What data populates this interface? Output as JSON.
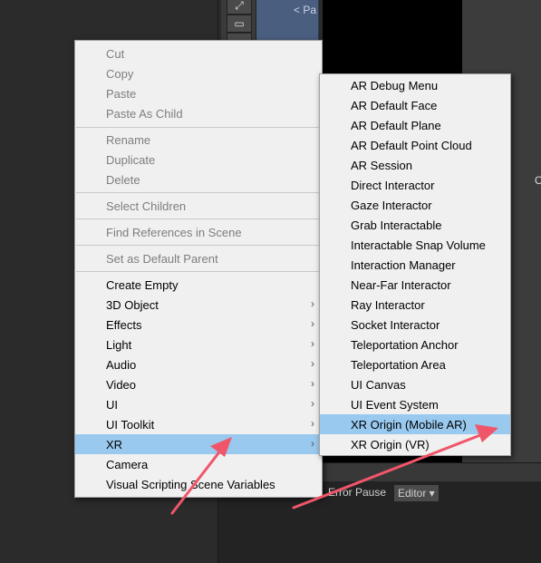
{
  "tool_icons": [
    "move-tool-icon",
    "rect-tool-icon",
    "transform-tool-icon"
  ],
  "panel_text": "< Pa",
  "bottom_toolbar": {
    "error_pause": "Error Pause",
    "editor": "Editor ▾"
  },
  "side_char": "O",
  "context_menu": {
    "cut": "Cut",
    "copy": "Copy",
    "paste": "Paste",
    "paste_as_child": "Paste As Child",
    "rename": "Rename",
    "duplicate": "Duplicate",
    "delete": "Delete",
    "select_children": "Select Children",
    "find_references": "Find References in Scene",
    "set_default_parent": "Set as Default Parent",
    "create_empty": "Create Empty",
    "object_3d": "3D Object",
    "effects": "Effects",
    "light": "Light",
    "audio": "Audio",
    "video": "Video",
    "ui": "UI",
    "ui_toolkit": "UI Toolkit",
    "xr": "XR",
    "camera": "Camera",
    "visual_scripting": "Visual Scripting Scene Variables",
    "submenu_arrow": "›"
  },
  "xr_submenu": [
    "AR Debug Menu",
    "AR Default Face",
    "AR Default Plane",
    "AR Default Point Cloud",
    "AR Session",
    "Direct Interactor",
    "Gaze Interactor",
    "Grab Interactable",
    "Interactable Snap Volume",
    "Interaction Manager",
    "Near-Far Interactor",
    "Ray Interactor",
    "Socket Interactor",
    "Teleportation Anchor",
    "Teleportation Area",
    "UI Canvas",
    "UI Event System",
    "XR Origin (Mobile AR)",
    "XR Origin (VR)"
  ],
  "highlight_color": "#99c9ef",
  "annotation_arrow_color": "#f0566a"
}
